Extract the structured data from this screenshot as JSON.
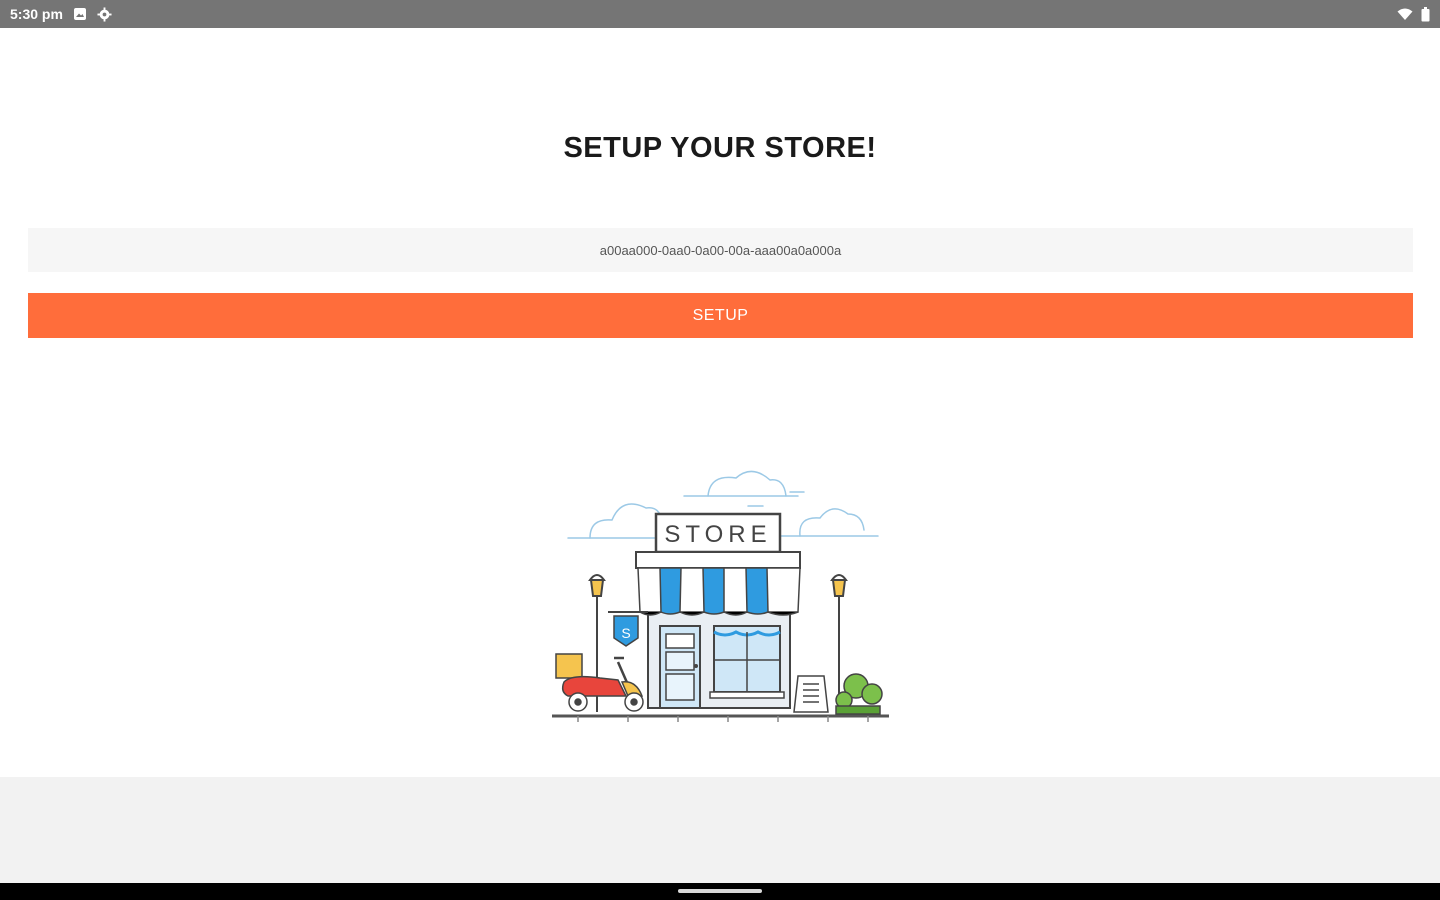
{
  "status_bar": {
    "time": "5:30 pm",
    "icons_left": [
      "image-notification-icon",
      "settings-gear-icon"
    ],
    "icons_right": [
      "wifi-icon",
      "battery-icon"
    ]
  },
  "main": {
    "title": "SETUP YOUR STORE!",
    "token_input_value": "a00aa000-0aa0-0a00-00a-aaa00a0a000a",
    "setup_button_label": "SETUP"
  },
  "illustration": {
    "sign_text": "STORE",
    "hanging_sign_text": "S"
  },
  "colors": {
    "accent": "#ff6d3b",
    "status_bar": "#757575",
    "input_bg": "#f6f6f6",
    "footer_bg": "#f2f2f2",
    "awning_blue": "#2f9be0",
    "scooter_red": "#e8453c"
  }
}
